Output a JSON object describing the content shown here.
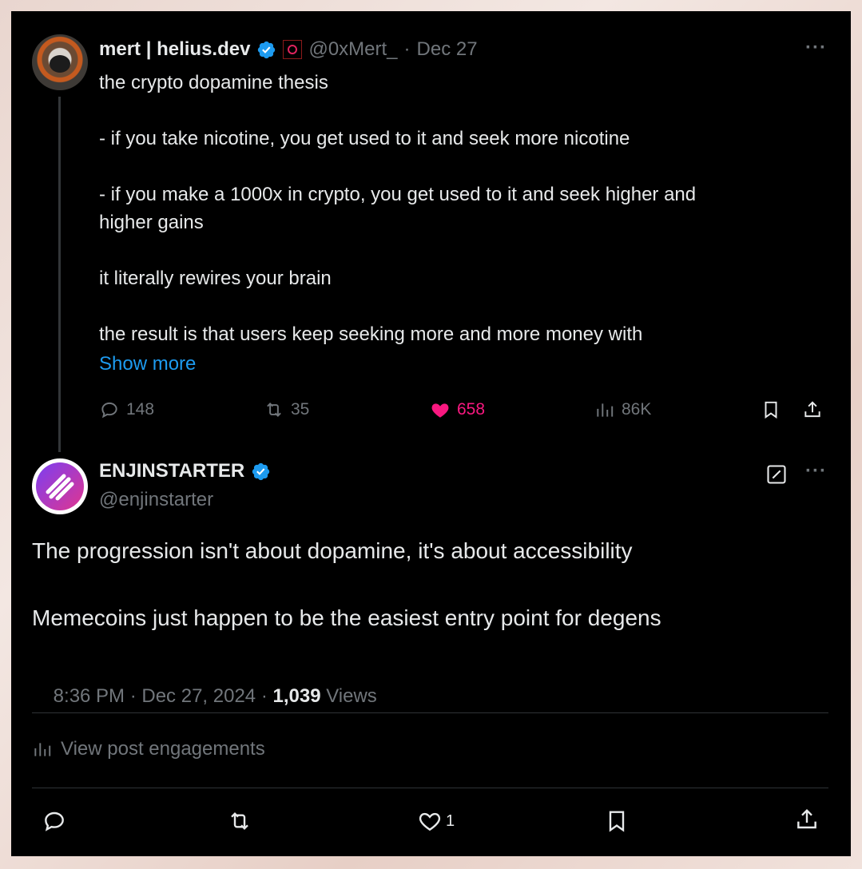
{
  "original_post": {
    "display_name": "mert | helius.dev",
    "handle": "@0xMert_",
    "separator": "·",
    "date": "Dec 27",
    "more_label": "···",
    "body": "the crypto dopamine thesis\n\n- if you take nicotine, you get used to it and seek more nicotine\n\n- if you make a 1000x in crypto, you get used to it and seek higher and\nhigher gains\n\nit literally rewires your brain\n\nthe result is that users keep seeking more and more money with",
    "show_more": "Show more",
    "stats": {
      "replies": "148",
      "reposts": "35",
      "likes": "658",
      "views": "86K"
    }
  },
  "reply_post": {
    "display_name": "ENJINSTARTER",
    "handle": "@enjinstarter",
    "more_label": "···",
    "line1": "The progression isn't about dopamine, it's about accessibility",
    "line2": "Memecoins just happen to be the easiest entry point for degens",
    "timestamp": "8:36 PM · Dec 27, 2024 · ",
    "views_count": "1,039",
    "views_label": " Views",
    "engagements_label": "View post engagements",
    "likes": "1"
  },
  "colors": {
    "background": "#000000",
    "text": "#e7e9ea",
    "muted": "#71767b",
    "link": "#1d9bf0",
    "like": "#f91880",
    "verified": "#1d9bf0"
  }
}
